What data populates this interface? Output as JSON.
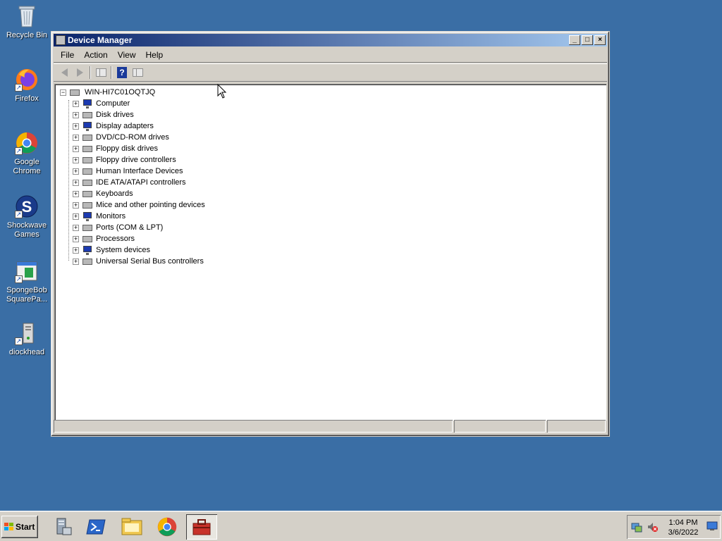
{
  "desktop": {
    "icons": [
      {
        "label": "Recycle Bin",
        "icon": "recycle-bin-icon"
      },
      {
        "label": "Firefox",
        "icon": "firefox-icon"
      },
      {
        "label": "Google Chrome",
        "icon": "chrome-icon"
      },
      {
        "label": "Shockwave Games",
        "icon": "shockwave-icon"
      },
      {
        "label": "SpongeBob SquarePa...",
        "icon": "spongebob-icon"
      },
      {
        "label": "diockhead",
        "icon": "computer-user-icon"
      }
    ]
  },
  "window": {
    "title": "Device Manager",
    "buttons": {
      "minimize": "_",
      "maximize": "□",
      "close": "×"
    },
    "menu": [
      "File",
      "Action",
      "View",
      "Help"
    ],
    "toolbar": [
      "back-icon",
      "forward-icon",
      "show-hide-tree-icon",
      "help-icon",
      "properties-icon"
    ],
    "tree": {
      "root": "WIN-HI7C01OQTJQ",
      "root_expander": "−",
      "node_expander": "+",
      "nodes": [
        "Computer",
        "Disk drives",
        "Display adapters",
        "DVD/CD-ROM drives",
        "Floppy disk drives",
        "Floppy drive controllers",
        "Human Interface Devices",
        "IDE ATA/ATAPI controllers",
        "Keyboards",
        "Mice and other pointing devices",
        "Monitors",
        "Ports (COM & LPT)",
        "Processors",
        "System devices",
        "Universal Serial Bus controllers"
      ]
    }
  },
  "taskbar": {
    "start_label": "Start",
    "apps": [
      "server-manager-icon",
      "powershell-icon",
      "file-explorer-icon",
      "chrome-icon",
      "toolbox-icon"
    ],
    "clock_time": "1:04 PM",
    "clock_date": "3/6/2022"
  },
  "colors": {
    "desktop": "#3a6ea5",
    "titlebar_start": "#0a246a",
    "titlebar_end": "#a6caf0",
    "window_face": "#d4d0c8"
  }
}
